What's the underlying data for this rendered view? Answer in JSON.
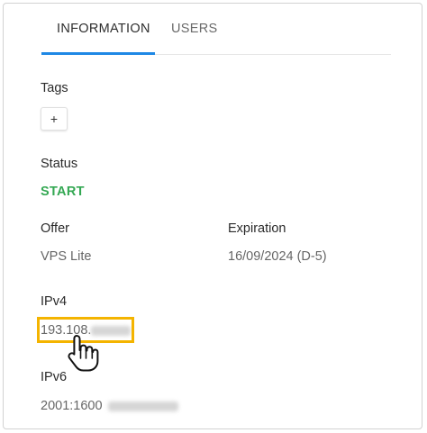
{
  "tabs": [
    {
      "label": "INFORMATION",
      "active": true
    },
    {
      "label": "USERS",
      "active": false
    }
  ],
  "tags": {
    "label": "Tags",
    "add_label": "+"
  },
  "status": {
    "label": "Status",
    "value": "START",
    "color": "#34a853"
  },
  "offer": {
    "label": "Offer",
    "value": "VPS Lite"
  },
  "expiration": {
    "label": "Expiration",
    "value": "16/09/2024 (D-5)"
  },
  "ipv4": {
    "label": "IPv4",
    "value_visible": "193.108."
  },
  "ipv6": {
    "label": "IPv6",
    "value_visible": "2001:1600"
  },
  "colors": {
    "accent": "#1e88e5",
    "highlight": "#f4b400"
  },
  "icons": {
    "cursor": "hand-pointer-icon"
  }
}
